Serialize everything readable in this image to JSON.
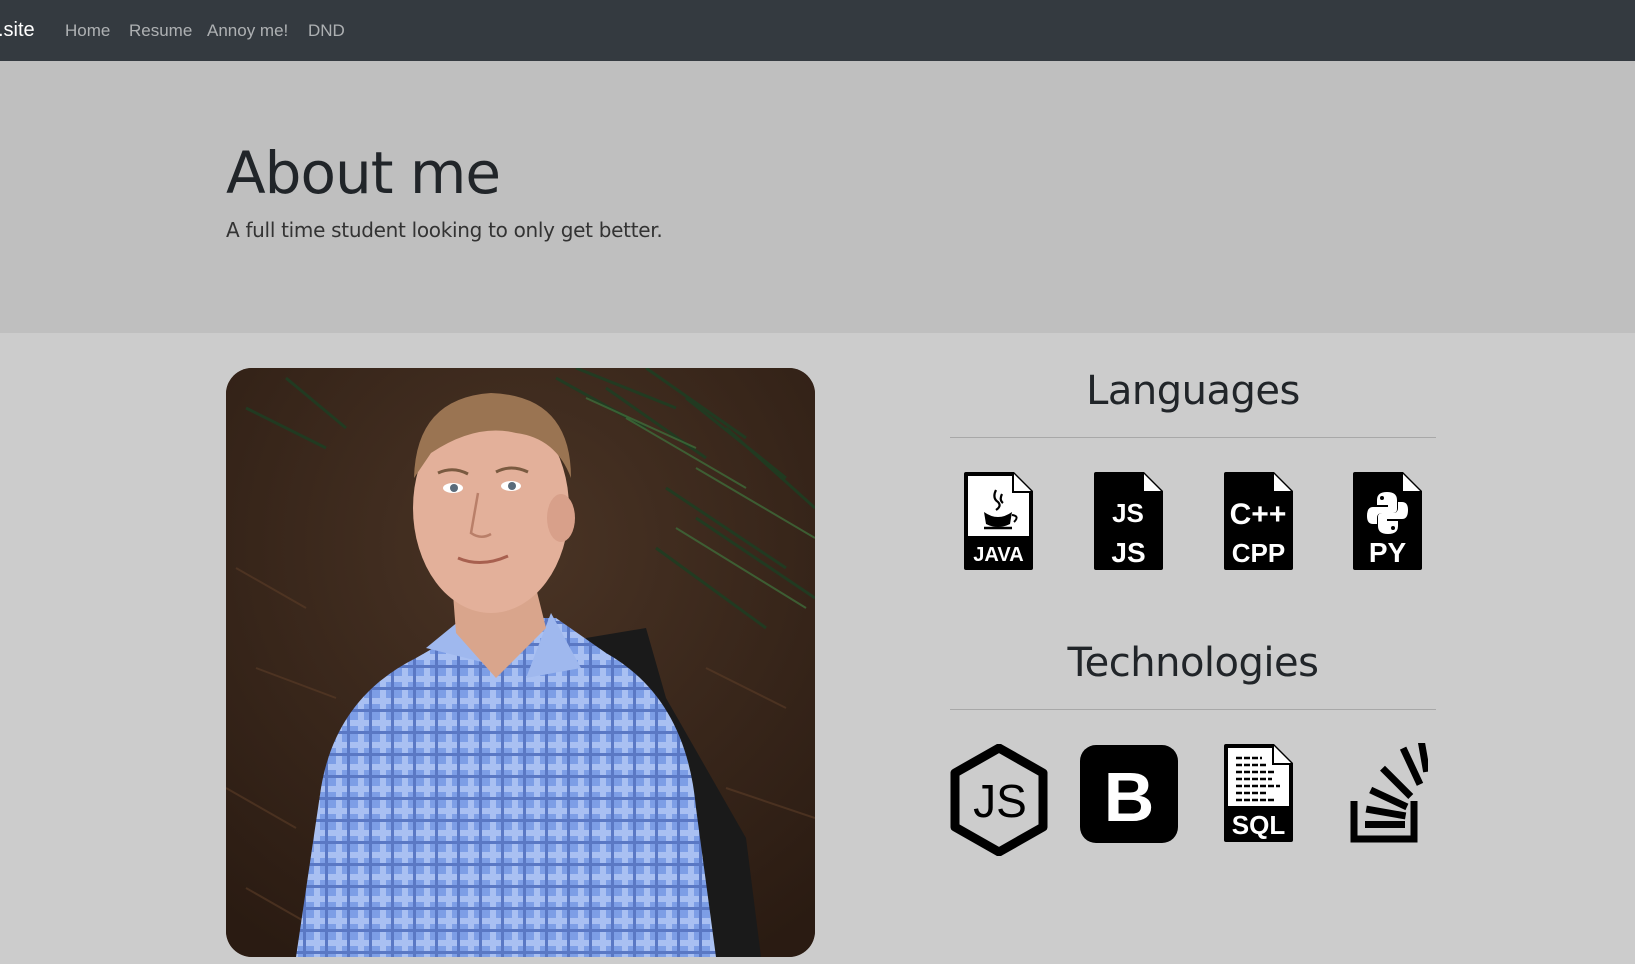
{
  "navbar": {
    "brand": ".site",
    "links": [
      {
        "label": "Home"
      },
      {
        "label": "Resume"
      },
      {
        "label": "Annoy me!"
      },
      {
        "label": "DND"
      }
    ]
  },
  "jumbotron": {
    "title": "About me",
    "subtitle": "A full time student looking to only get better."
  },
  "languages": {
    "heading": "Languages",
    "icons": [
      {
        "name": "java-file-icon",
        "label": "JAVA"
      },
      {
        "name": "js-file-icon",
        "label": "JS",
        "badge": "JS"
      },
      {
        "name": "cpp-file-icon",
        "label": "CPP",
        "badge": "C++"
      },
      {
        "name": "python-file-icon",
        "label": "PY"
      }
    ]
  },
  "technologies": {
    "heading": "Technologies",
    "icons": [
      {
        "name": "nodejs-icon",
        "label": "JS"
      },
      {
        "name": "bootstrap-icon",
        "label": "B"
      },
      {
        "name": "sql-file-icon",
        "label": "SQL"
      },
      {
        "name": "stackoverflow-icon"
      }
    ]
  },
  "colors": {
    "navbar": "#343a40",
    "jumbotron": "#bfbfbf",
    "page": "#cccccc"
  }
}
